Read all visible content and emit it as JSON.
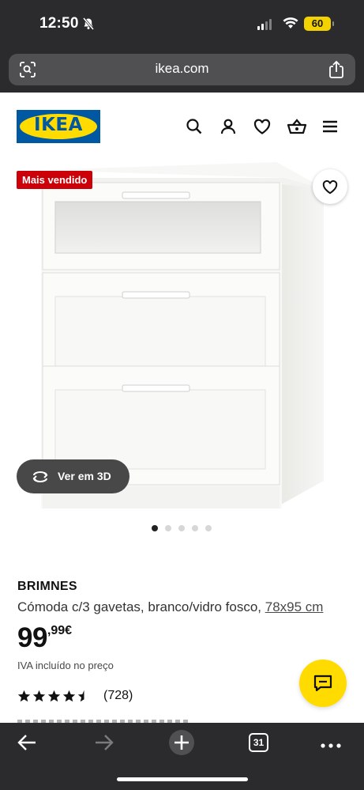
{
  "status_bar": {
    "time": "12:50",
    "battery": "60",
    "bell_icon": "bell-slash-icon",
    "signal_icon": "cell-signal-icon",
    "wifi_icon": "wifi-icon"
  },
  "browser": {
    "url": "ikea.com",
    "left_icon": "page-settings-icon",
    "right_icon": "share-icon",
    "tabs_count": "31"
  },
  "header": {
    "logo_text": "IKEA",
    "logo_colors": {
      "blue": "#0058a3",
      "yellow": "#ffdb00"
    },
    "icons": [
      "search-icon",
      "profile-icon",
      "heart-icon",
      "basket-icon",
      "menu-icon"
    ]
  },
  "gallery": {
    "badge": "Mais vendido",
    "badge_color": "#cc0008",
    "view_3d_label": "Ver em 3D",
    "image_count": 5,
    "active_image": 1
  },
  "product": {
    "name": "BRIMNES",
    "description": "Cómoda c/3 gavetas, branco/vidro fosco,",
    "size_link": "78x95 cm",
    "price_integer": "99",
    "price_decimal": ",99€",
    "tax_note": "IVA incluído no preço",
    "rating": 4.5,
    "review_count": "(728)"
  },
  "toolbar": {
    "icons": [
      "back-arrow-icon",
      "forward-arrow-icon",
      "new-tab-icon",
      "tabs-icon",
      "more-icon"
    ]
  }
}
